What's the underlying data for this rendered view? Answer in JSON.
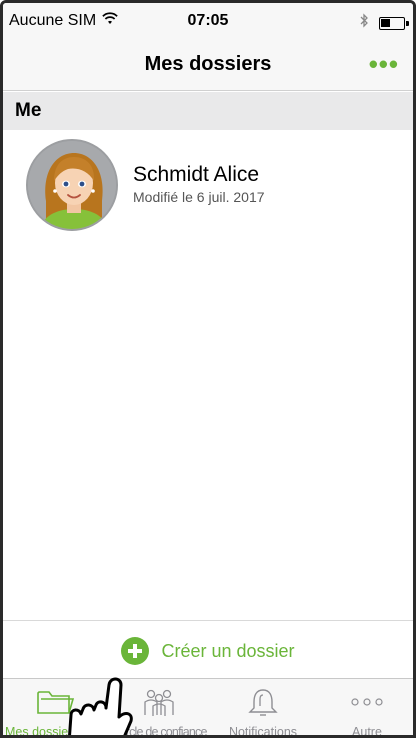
{
  "status_bar": {
    "carrier": "Aucune SIM",
    "time": "07:05"
  },
  "nav": {
    "title": "Mes dossiers",
    "more_label": "•••"
  },
  "section": {
    "title": "Me"
  },
  "records": [
    {
      "name": "Schmidt Alice",
      "modified": "Modifié le 6 juil. 2017"
    }
  ],
  "create": {
    "label": "Créer un dossier"
  },
  "tabs": [
    {
      "label": "Mes dossiers",
      "icon": "folder-icon",
      "active": true
    },
    {
      "label": "Cercle de confiance",
      "icon": "people-icon",
      "active": false
    },
    {
      "label": "Notifications",
      "icon": "bell-icon",
      "active": false
    },
    {
      "label": "Autre",
      "icon": "more-dots-icon",
      "active": false
    }
  ],
  "colors": {
    "accent": "#6ab539",
    "inactive": "#8e8e93",
    "section_bg": "#e9e9ea",
    "bar_bg": "#f7f7f7"
  }
}
